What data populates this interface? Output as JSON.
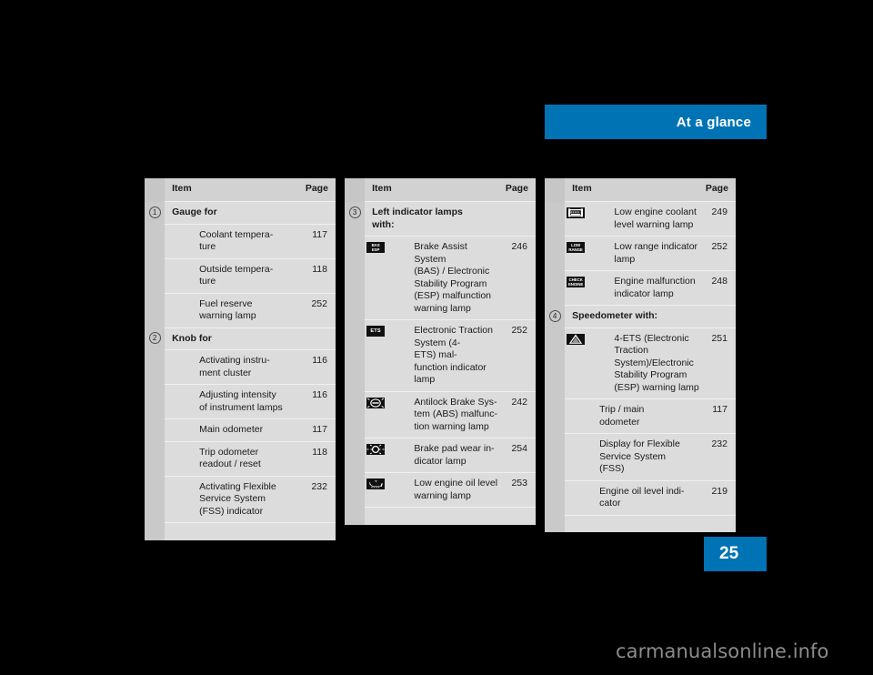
{
  "banner": {
    "title": "At a glance"
  },
  "page": {
    "number": "25"
  },
  "watermark": {
    "text": "carmanualsonline.info"
  },
  "columns": [
    {
      "id": "column-1",
      "header": {
        "item": "Item",
        "page": "Page"
      },
      "rows": [
        {
          "type": "group",
          "marker": "1",
          "item": "Gauge for",
          "page": ""
        },
        {
          "type": "entry",
          "item": "Coolant tempera-\nture",
          "page": "117"
        },
        {
          "type": "entry",
          "item": "Outside tempera-\nture",
          "page": "118"
        },
        {
          "type": "entry",
          "item": "Fuel reserve\nwarning lamp",
          "page": "252"
        },
        {
          "type": "group",
          "marker": "2",
          "item": "Knob for",
          "page": ""
        },
        {
          "type": "entry",
          "item": "Activating instru-\nment cluster",
          "page": "116"
        },
        {
          "type": "entry",
          "item": "Adjusting intensity\nof instrument lamps",
          "page": "116"
        },
        {
          "type": "entry",
          "item": "Main odometer",
          "page": "117"
        },
        {
          "type": "entry",
          "item": "Trip odometer\nreadout / reset",
          "page": "118"
        },
        {
          "type": "entry",
          "item": "Activating Flexible\nService System\n(FSS) indicator",
          "page": "232"
        }
      ]
    },
    {
      "id": "column-2",
      "header": {
        "item": "Item",
        "page": "Page"
      },
      "rows": [
        {
          "type": "group",
          "marker": "3",
          "item": "Left indicator lamps\nwith:",
          "page": ""
        },
        {
          "type": "icon",
          "icon": "bas-esp-icon",
          "icon_text": "BAS\nESP",
          "item": "Brake Assist\nSystem\n(BAS) / Electronic\nStability Program\n(ESP) malfunction\nwarning lamp",
          "page": "246"
        },
        {
          "type": "icon",
          "icon": "ets-icon",
          "icon_text": "ETS",
          "item": "Electronic Traction\nSystem (4-ETS) mal-\nfunction indicator\nlamp",
          "page": "252"
        },
        {
          "type": "icon",
          "icon": "abs-icon",
          "icon_text": "",
          "item": "Antilock Brake Sys-\ntem (ABS) malfunc-\ntion warning lamp",
          "page": "242"
        },
        {
          "type": "icon",
          "icon": "brake-pad-wear-icon",
          "icon_text": "",
          "item": "Brake pad wear in-\ndicator lamp",
          "page": "254"
        },
        {
          "type": "icon",
          "icon": "engine-oil-level-icon",
          "icon_text": "",
          "item": "Low engine oil level\nwarning lamp",
          "page": "253"
        }
      ]
    },
    {
      "id": "column-3",
      "header": {
        "item": "Item",
        "page": "Page"
      },
      "rows": [
        {
          "type": "icon",
          "icon": "coolant-level-icon",
          "icon_text": "",
          "item": "Low engine coolant\nlevel warning lamp",
          "page": "249"
        },
        {
          "type": "icon",
          "icon": "low-range-icon",
          "icon_text": "LOW\nRANGE",
          "item": "Low range indicator\nlamp",
          "page": "252"
        },
        {
          "type": "icon",
          "icon": "check-engine-icon",
          "icon_text": "CHECK\nENGINE",
          "item": "Engine malfunction\nindicator lamp",
          "page": "248"
        },
        {
          "type": "group",
          "marker": "4",
          "item": "Speedometer with:",
          "page": ""
        },
        {
          "type": "icon",
          "icon": "4ets-esp-warning-icon",
          "icon_text": "",
          "item": "4-ETS (Electronic\nTraction\nSystem)/Electronic\nStability Program\n(ESP) warning lamp",
          "page": "251"
        },
        {
          "type": "entry",
          "item": "Trip / main\nodometer",
          "page": "117"
        },
        {
          "type": "entry",
          "item": "Display for Flexible\nService System\n(FSS)",
          "page": "232"
        },
        {
          "type": "entry",
          "item": "Engine oil level indi-\ncator",
          "page": "219"
        }
      ]
    }
  ],
  "colors": {
    "accent": "#0073b5",
    "table_cell": "#dcdcdc",
    "table_gutter": "#c9c9c9",
    "table_header": "#d2d2d2",
    "icon": "#111111"
  }
}
